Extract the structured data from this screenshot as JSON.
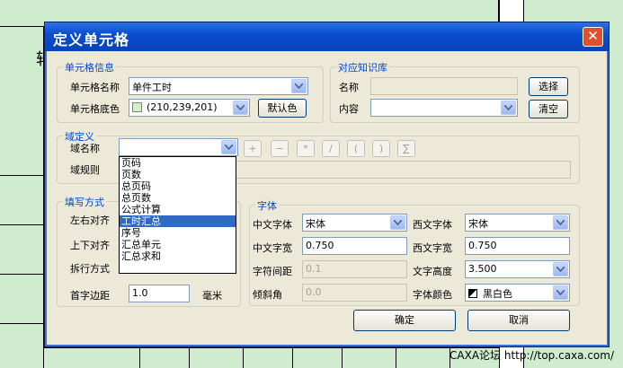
{
  "background_sheet": {
    "left_char": "转"
  },
  "watermark": "CAXA论坛 http://top.caxa.com/",
  "dialog": {
    "title": "定义单元格",
    "close_glyph": "✕"
  },
  "cell_info": {
    "legend": "单元格信息",
    "name_label": "单元格名称",
    "name_value": "单件工时",
    "bgcolor_label": "单元格底色",
    "bgcolor_value": "(210,239,201)",
    "default_color_button": "默认色"
  },
  "knowledge": {
    "legend": "对应知识库",
    "name_label": "名称",
    "name_value": "",
    "content_label": "内容",
    "content_value": "",
    "select_button": "选择",
    "clear_button": "清空"
  },
  "domain": {
    "legend": "域定义",
    "name_label": "域名称",
    "name_value": "",
    "rule_label": "域规则",
    "operators": [
      "+",
      "−",
      "*",
      "/",
      "(",
      ")",
      "∑"
    ],
    "options": [
      "页码",
      "页数",
      "总页码",
      "总页数",
      "公式计算",
      "工时汇总",
      "序号",
      "汇总单元",
      "汇总求和"
    ],
    "selected_option": "工时汇总"
  },
  "fill": {
    "legend": "填写方式",
    "align_h_label": "左右对齐",
    "align_v_label": "上下对齐",
    "wrap_label": "拆行方式",
    "indent_label": "首字边距",
    "indent_value": "1.0",
    "indent_unit": "毫米"
  },
  "font": {
    "legend": "字体",
    "cn_font_label": "中文字体",
    "cn_font_value": "宋体",
    "west_font_label": "西文字体",
    "west_font_value": "宋体",
    "cn_width_label": "中文字宽",
    "cn_width_value": "0.750",
    "west_width_label": "西文字宽",
    "west_width_value": "0.750",
    "spacing_label": "字符间距",
    "spacing_value": "0.1",
    "height_label": "文字高度",
    "height_value": "3.500",
    "slant_label": "倾斜角",
    "slant_value": "0.0",
    "color_label": "字体颜色",
    "color_value": "黑白色"
  },
  "buttons": {
    "ok": "确定",
    "cancel": "取消"
  }
}
